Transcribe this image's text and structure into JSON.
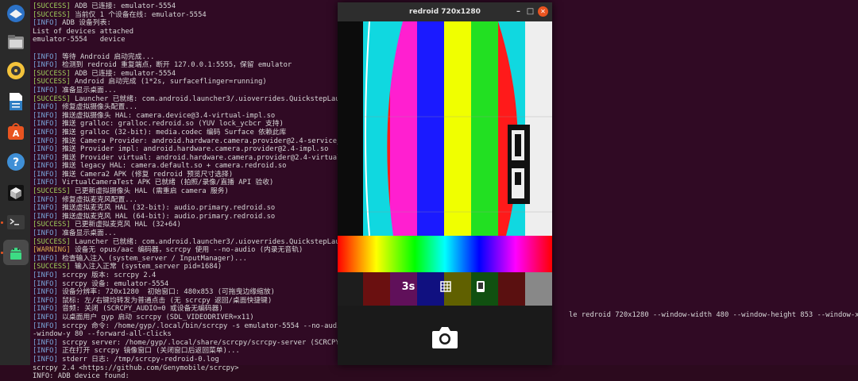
{
  "window": {
    "title": "redroid 720x1280"
  },
  "terminal": {
    "lines": [
      {
        "tag": "[SUCCESS]",
        "type": "success",
        "text": " ADB 已连接: emulator-5554"
      },
      {
        "tag": "[SUCCESS]",
        "type": "success",
        "text": " 当前仅 1 个设备在线: emulator-5554"
      },
      {
        "tag": "[INFO]",
        "type": "info",
        "text": " ADB 设备列表:"
      },
      {
        "tag": "",
        "type": "plain",
        "text": "List of devices attached"
      },
      {
        "tag": "",
        "type": "plain",
        "text": "emulator-5554   device"
      },
      {
        "tag": "",
        "type": "plain",
        "text": ""
      },
      {
        "tag": "[INFO]",
        "type": "info",
        "text": " 等待 Android 启动完成..."
      },
      {
        "tag": "[INFO]",
        "type": "info",
        "text": " 检测到 redroid 重复端点，断开 127.0.0.1:5555，保留 emulator"
      },
      {
        "tag": "[SUCCESS]",
        "type": "success",
        "text": " ADB 已连接: emulator-5554"
      },
      {
        "tag": "[SUCCESS]",
        "type": "success",
        "text": " Android 启动完成 (1*2s, surfaceflinger=running)"
      },
      {
        "tag": "[INFO]",
        "type": "info",
        "text": " 准备显示桌面..."
      },
      {
        "tag": "[SUCCESS]",
        "type": "success",
        "text": " Launcher 已就绪: com.android.launcher3/.uioverrides.QuickstepLaunc"
      },
      {
        "tag": "[INFO]",
        "type": "info",
        "text": " 修复虚拟摄像头配置..."
      },
      {
        "tag": "[INFO]",
        "type": "info",
        "text": " 推送虚拟摄像头 HAL: camera.device@3.4-virtual-impl.so"
      },
      {
        "tag": "[INFO]",
        "type": "info",
        "text": " 推送 gralloc: gralloc.redroid.so (YUV lock_ycbcr 支持)"
      },
      {
        "tag": "[INFO]",
        "type": "info",
        "text": " 推送 gralloc (32-bit): media.codec 编码 Surface 依赖此库"
      },
      {
        "tag": "[INFO]",
        "type": "info",
        "text": " 推送 Camera Provider: android.hardware.camera.provider@2.4-service_64"
      },
      {
        "tag": "[INFO]",
        "type": "info",
        "text": " 推送 Provider impl: android.hardware.camera.provider@2.4-impl.so"
      },
      {
        "tag": "[INFO]",
        "type": "info",
        "text": " 推送 Provider virtual: android.hardware.camera.provider@2.4-virtual.s"
      },
      {
        "tag": "[INFO]",
        "type": "info",
        "text": " 推送 legacy HAL: camera.default.so + camera.redroid.so"
      },
      {
        "tag": "[INFO]",
        "type": "info",
        "text": " 推送 Camera2 APK (修复 redroid 预览尺寸选择)"
      },
      {
        "tag": "[INFO]",
        "type": "info",
        "text": " VirtualCameraTest APK 已就绪 (拍照/录像/直播 API 验收)"
      },
      {
        "tag": "[SUCCESS]",
        "type": "success",
        "text": " 已更新虚拟摄像头 HAL (需重启 camera 服务)"
      },
      {
        "tag": "[INFO]",
        "type": "info",
        "text": " 修复虚拟麦克风配置..."
      },
      {
        "tag": "[INFO]",
        "type": "info",
        "text": " 推送虚拟麦克风 HAL (32-bit): audio.primary.redroid.so"
      },
      {
        "tag": "[INFO]",
        "type": "info",
        "text": " 推送虚拟麦克风 HAL (64-bit): audio.primary.redroid.so"
      },
      {
        "tag": "[SUCCESS]",
        "type": "success",
        "text": " 已更新虚拟麦克风 HAL (32+64)"
      },
      {
        "tag": "[INFO]",
        "type": "info",
        "text": " 准备显示桌面..."
      },
      {
        "tag": "[SUCCESS]",
        "type": "success",
        "text": " Launcher 已就绪: com.android.launcher3/.uioverrides.QuickstepLaunc"
      },
      {
        "tag": "[WARNING]",
        "type": "warning",
        "text": " 设备无 opus/aac 编码器，scrcpy 使用 --no-audio (内录无音轨)"
      },
      {
        "tag": "[INFO]",
        "type": "info",
        "text": " 检查输入注入 (system_server / InputManager)..."
      },
      {
        "tag": "[SUCCESS]",
        "type": "success",
        "text": " 输入注入正常 (system_server pid=1684)"
      },
      {
        "tag": "[INFO]",
        "type": "info",
        "text": " scrcpy 版本: scrcpy 2.4"
      },
      {
        "tag": "[INFO]",
        "type": "info",
        "text": " scrcpy 设备: emulator-5554"
      },
      {
        "tag": "[INFO]",
        "type": "info",
        "text": " 设备分辨率: 720x1280  初始窗口: 480x853 (可拖曳边缘缩放)"
      },
      {
        "tag": "[INFO]",
        "type": "info",
        "text": " 鼠标: 左/右键均转发为普通点击 (无 scrcpy 返回/桌面快捷键)"
      },
      {
        "tag": "[INFO]",
        "type": "info",
        "text": " 音频: 关闭 (SCRCPY_AUDIO=0 或设备无编码器)"
      },
      {
        "tag": "[INFO]",
        "type": "info",
        "text": " 以桌面用户 gyp 启动 scrcpy (SDL_VIDEODRIVER=x11)"
      },
      {
        "tag": "[INFO]",
        "type": "info",
        "text": " scrcpy 命令: /home/gyp/.local/bin/scrcpy -s emulator-5554 --no-audio"
      },
      {
        "tag": "",
        "type": "plain",
        "text": "-window-y 80 --forward-all-clicks"
      },
      {
        "tag": "[INFO]",
        "type": "info",
        "text": " scrcpy server: /home/gyp/.local/share/scrcpy/scrcpy-server (SCRCPY_SE"
      },
      {
        "tag": "[INFO]",
        "type": "info",
        "text": " 正在打开 scrcpy 镜像窗口 (关闭窗口后返回菜单)..."
      },
      {
        "tag": "[INFO]",
        "type": "info",
        "text": " stderr 日志: /tmp/scrcpy-redroid-0.log"
      },
      {
        "tag": "",
        "type": "plain",
        "text": "scrcpy 2.4 <https://github.com/Genymobile/scrcpy>"
      },
      {
        "tag": "",
        "type": "plain",
        "text": "INFO: ADB device found:"
      }
    ],
    "continuation_1": "le redroid 720x1280 --window-width 480 --window-height 853 --window-x 80 -",
    "continuation_2": "le redroid 720x1280 --window-width 480 --window-height 853 --window-x 80 -"
  },
  "camera_overlay": {
    "timer_label": "3s",
    "grid_icon": "grid-icon",
    "orientation_icon": "phone-orientation-icon",
    "shutter_icon": "camera-shutter-icon"
  },
  "dock": {
    "items": [
      "thunderbird-icon",
      "files-icon",
      "rhythmbox-icon",
      "writer-icon",
      "software-icon",
      "help-icon",
      "cube-icon",
      "terminal-icon",
      "android-icon"
    ]
  },
  "colors": {
    "terminal_bg": "#300a24",
    "success": "#9fd15c",
    "info": "#7aa6da",
    "warning": "#e0b050",
    "close_button": "#e95420"
  }
}
